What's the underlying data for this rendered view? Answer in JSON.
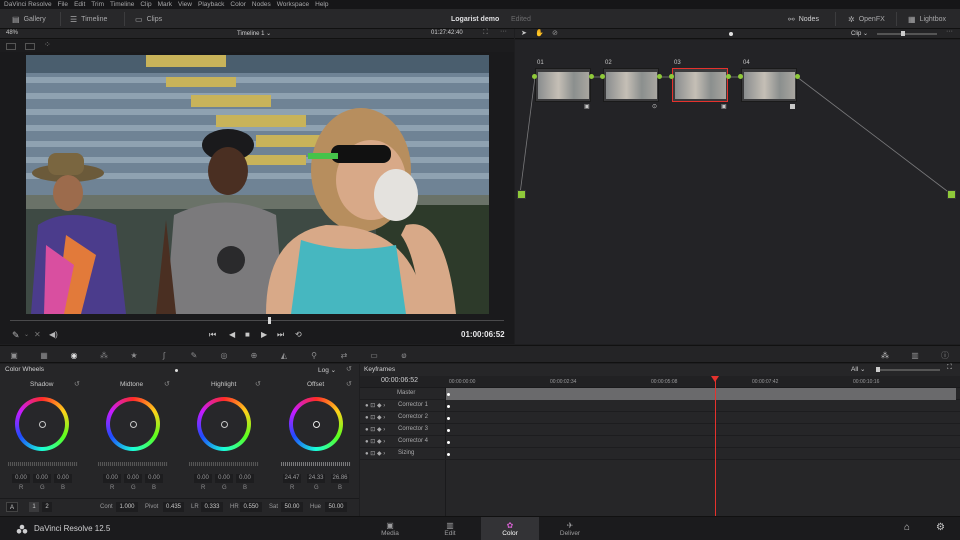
{
  "menu": [
    "DaVinci Resolve",
    "File",
    "Edit",
    "Trim",
    "Timeline",
    "Clip",
    "Mark",
    "View",
    "Playback",
    "Color",
    "Nodes",
    "Workspace",
    "Help"
  ],
  "topbar": {
    "gallery": "Gallery",
    "timeline": "Timeline",
    "clips": "Clips",
    "project_title": "Logarist demo",
    "project_status": "Edited",
    "nodes": "Nodes",
    "openfx": "OpenFX",
    "lightbox": "Lightbox"
  },
  "viewer": {
    "zoom": "48%",
    "timeline_name": "Timeline 1",
    "source_timecode": "01:27:42:40",
    "timecode": "01:00:06:52"
  },
  "node_editor": {
    "mode": "Clip",
    "nodes": [
      {
        "label": "01"
      },
      {
        "label": "02"
      },
      {
        "label": "03"
      },
      {
        "label": "04"
      }
    ]
  },
  "color_wheels": {
    "title": "Color Wheels",
    "mode": "Log",
    "wheels": [
      {
        "name": "Shadow",
        "values": [
          "0.00",
          "0.00",
          "0.00"
        ]
      },
      {
        "name": "Midtone",
        "values": [
          "0.00",
          "0.00",
          "0.00"
        ]
      },
      {
        "name": "Highlight",
        "values": [
          "0.00",
          "0.00",
          "0.00"
        ]
      },
      {
        "name": "Offset",
        "values": [
          "24.47",
          "24.33",
          "26.86"
        ]
      }
    ],
    "channel_labels": [
      "R",
      "G",
      "B"
    ],
    "footer": {
      "a_label": "A",
      "page1": "1",
      "page2": "2",
      "cont_label": "Cont",
      "cont": "1.000",
      "pivot_label": "Pivot",
      "pivot": "0.435",
      "lr_label": "LR",
      "lr": "0.333",
      "hr_label": "HR",
      "hr": "0.550",
      "sat_label": "Sat",
      "sat": "50.00",
      "hue_label": "Hue",
      "hue": "50.00"
    }
  },
  "keyframes": {
    "title": "Keyframes",
    "filter": "All",
    "current_time": "00:00:06:52",
    "ruler": [
      "00:00:00:00",
      "00:00:02:34",
      "00:00:05:08",
      "00:00:07:42",
      "00:00:10:16"
    ],
    "tracks": [
      "Master",
      "Corrector 1",
      "Corrector 2",
      "Corrector 3",
      "Corrector 4",
      "Sizing"
    ]
  },
  "bottom": {
    "app_name": "DaVinci Resolve 12.5",
    "tabs": [
      "Media",
      "Edit",
      "Color",
      "Deliver"
    ]
  },
  "colors": {
    "accent": "#e5322d",
    "node_connector": "#8fc93a",
    "panel_bg": "#262628"
  }
}
